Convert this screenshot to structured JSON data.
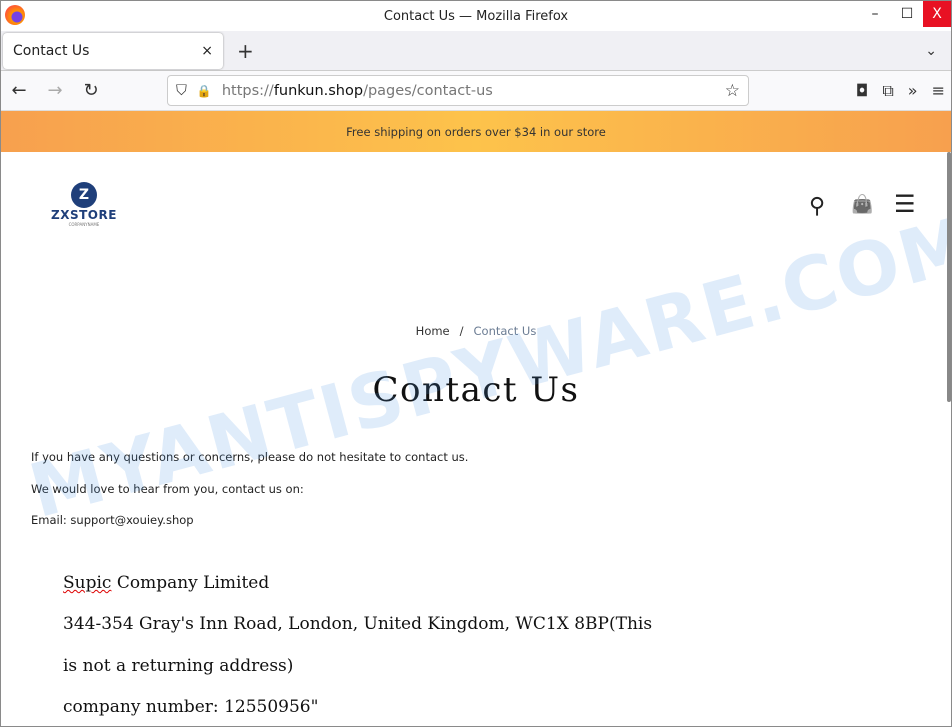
{
  "window": {
    "title": "Contact Us — Mozilla Firefox",
    "min": "–",
    "max": "☐",
    "close": "X"
  },
  "tab": {
    "label": "Contact Us",
    "close": "×",
    "new": "+",
    "list": "⌄"
  },
  "nav": {
    "back": "←",
    "forward": "→",
    "reload": "↻",
    "url_scheme": "https://",
    "url_host": "funkun.shop",
    "url_path": "/pages/contact-us",
    "shield": "⛉",
    "lock": "🔒",
    "star": "☆",
    "pocket": "◘",
    "extensions": "⧉",
    "more_tools": "»",
    "menu": "≡"
  },
  "banner": {
    "text": "Free shipping on orders over $34 in our store"
  },
  "store": {
    "logo_name": "ZXSTORE",
    "logo_sub": "CORPANYNAME",
    "logo_mark": "Z",
    "search": "⚲",
    "bag": "👜",
    "menu": "☰"
  },
  "breadcrumb": {
    "home": "Home",
    "sep": "/",
    "current": "Contact Us"
  },
  "page": {
    "title": "Contact Us",
    "paras": [
      "If you have any questions or concerns, please do not hesitate to contact us.",
      "We would love to hear from you, contact us on:",
      "Email: support@xouiey.shop"
    ],
    "address": {
      "company_a": "Supic",
      "company_b": " Company Limited",
      "line2": "344-354 Gray's Inn Road, London, United Kingdom, WC1X 8BP(This",
      "line3": "is not a returning address)",
      "line4": "company number: 12550956\""
    }
  },
  "watermark": "MYANTISPYWARE.COM",
  "colors": {
    "banner": "#fdc34b",
    "brand": "#1f3f7a",
    "close": "#e81123"
  }
}
